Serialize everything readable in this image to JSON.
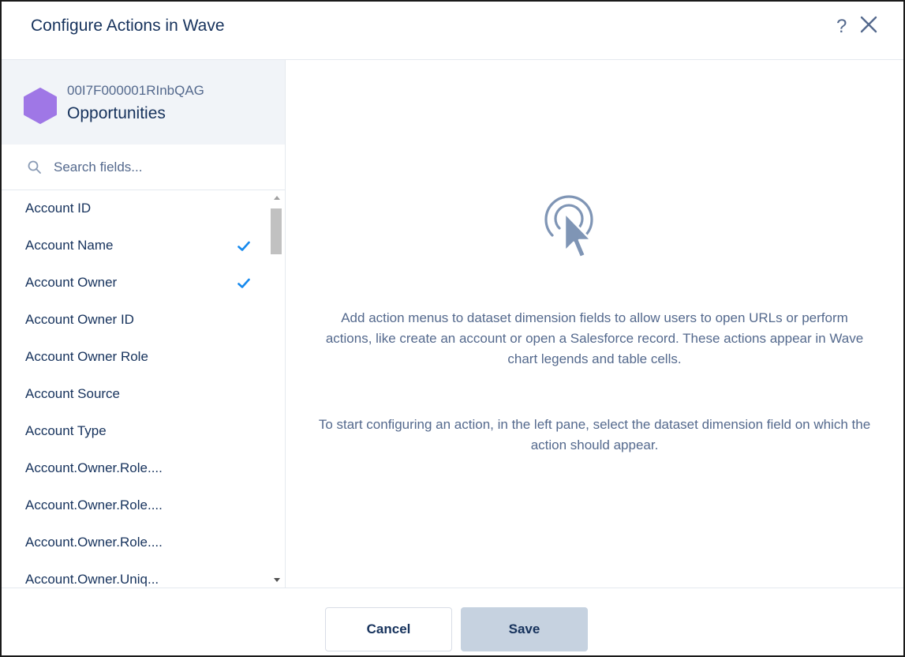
{
  "header": {
    "title": "Configure Actions in Wave",
    "help_glyph": "?"
  },
  "dataset": {
    "id": "00I7F000001RInbQAG",
    "name": "Opportunities",
    "icon": "hexagon-icon",
    "icon_color": "#9f77e6"
  },
  "search": {
    "placeholder": "Search fields..."
  },
  "fields": [
    {
      "label": "Account ID",
      "checked": false
    },
    {
      "label": "Account Name",
      "checked": true
    },
    {
      "label": "Account Owner",
      "checked": true
    },
    {
      "label": "Account Owner ID",
      "checked": false
    },
    {
      "label": "Account Owner Role",
      "checked": false
    },
    {
      "label": "Account Source",
      "checked": false
    },
    {
      "label": "Account Type",
      "checked": false
    },
    {
      "label": "Account.Owner.Role....",
      "checked": false
    },
    {
      "label": "Account.Owner.Role....",
      "checked": false
    },
    {
      "label": "Account.Owner.Role....",
      "checked": false
    },
    {
      "label": "Account.Owner.Uniq...",
      "checked": false
    }
  ],
  "main": {
    "description": "Add action menus to dataset dimension fields to allow users to open URLs or perform actions, like create an account or open a Salesforce record. These actions appear in Wave chart legends and table cells.",
    "instruction": "To start configuring an action, in the left pane, select the dataset dimension field on which the action should appear."
  },
  "footer": {
    "cancel_label": "Cancel",
    "save_label": "Save"
  },
  "colors": {
    "accent_check": "#1589ee",
    "text_primary": "#16325c",
    "text_secondary": "#54698d",
    "disabled_button": "#c6d2e0"
  }
}
